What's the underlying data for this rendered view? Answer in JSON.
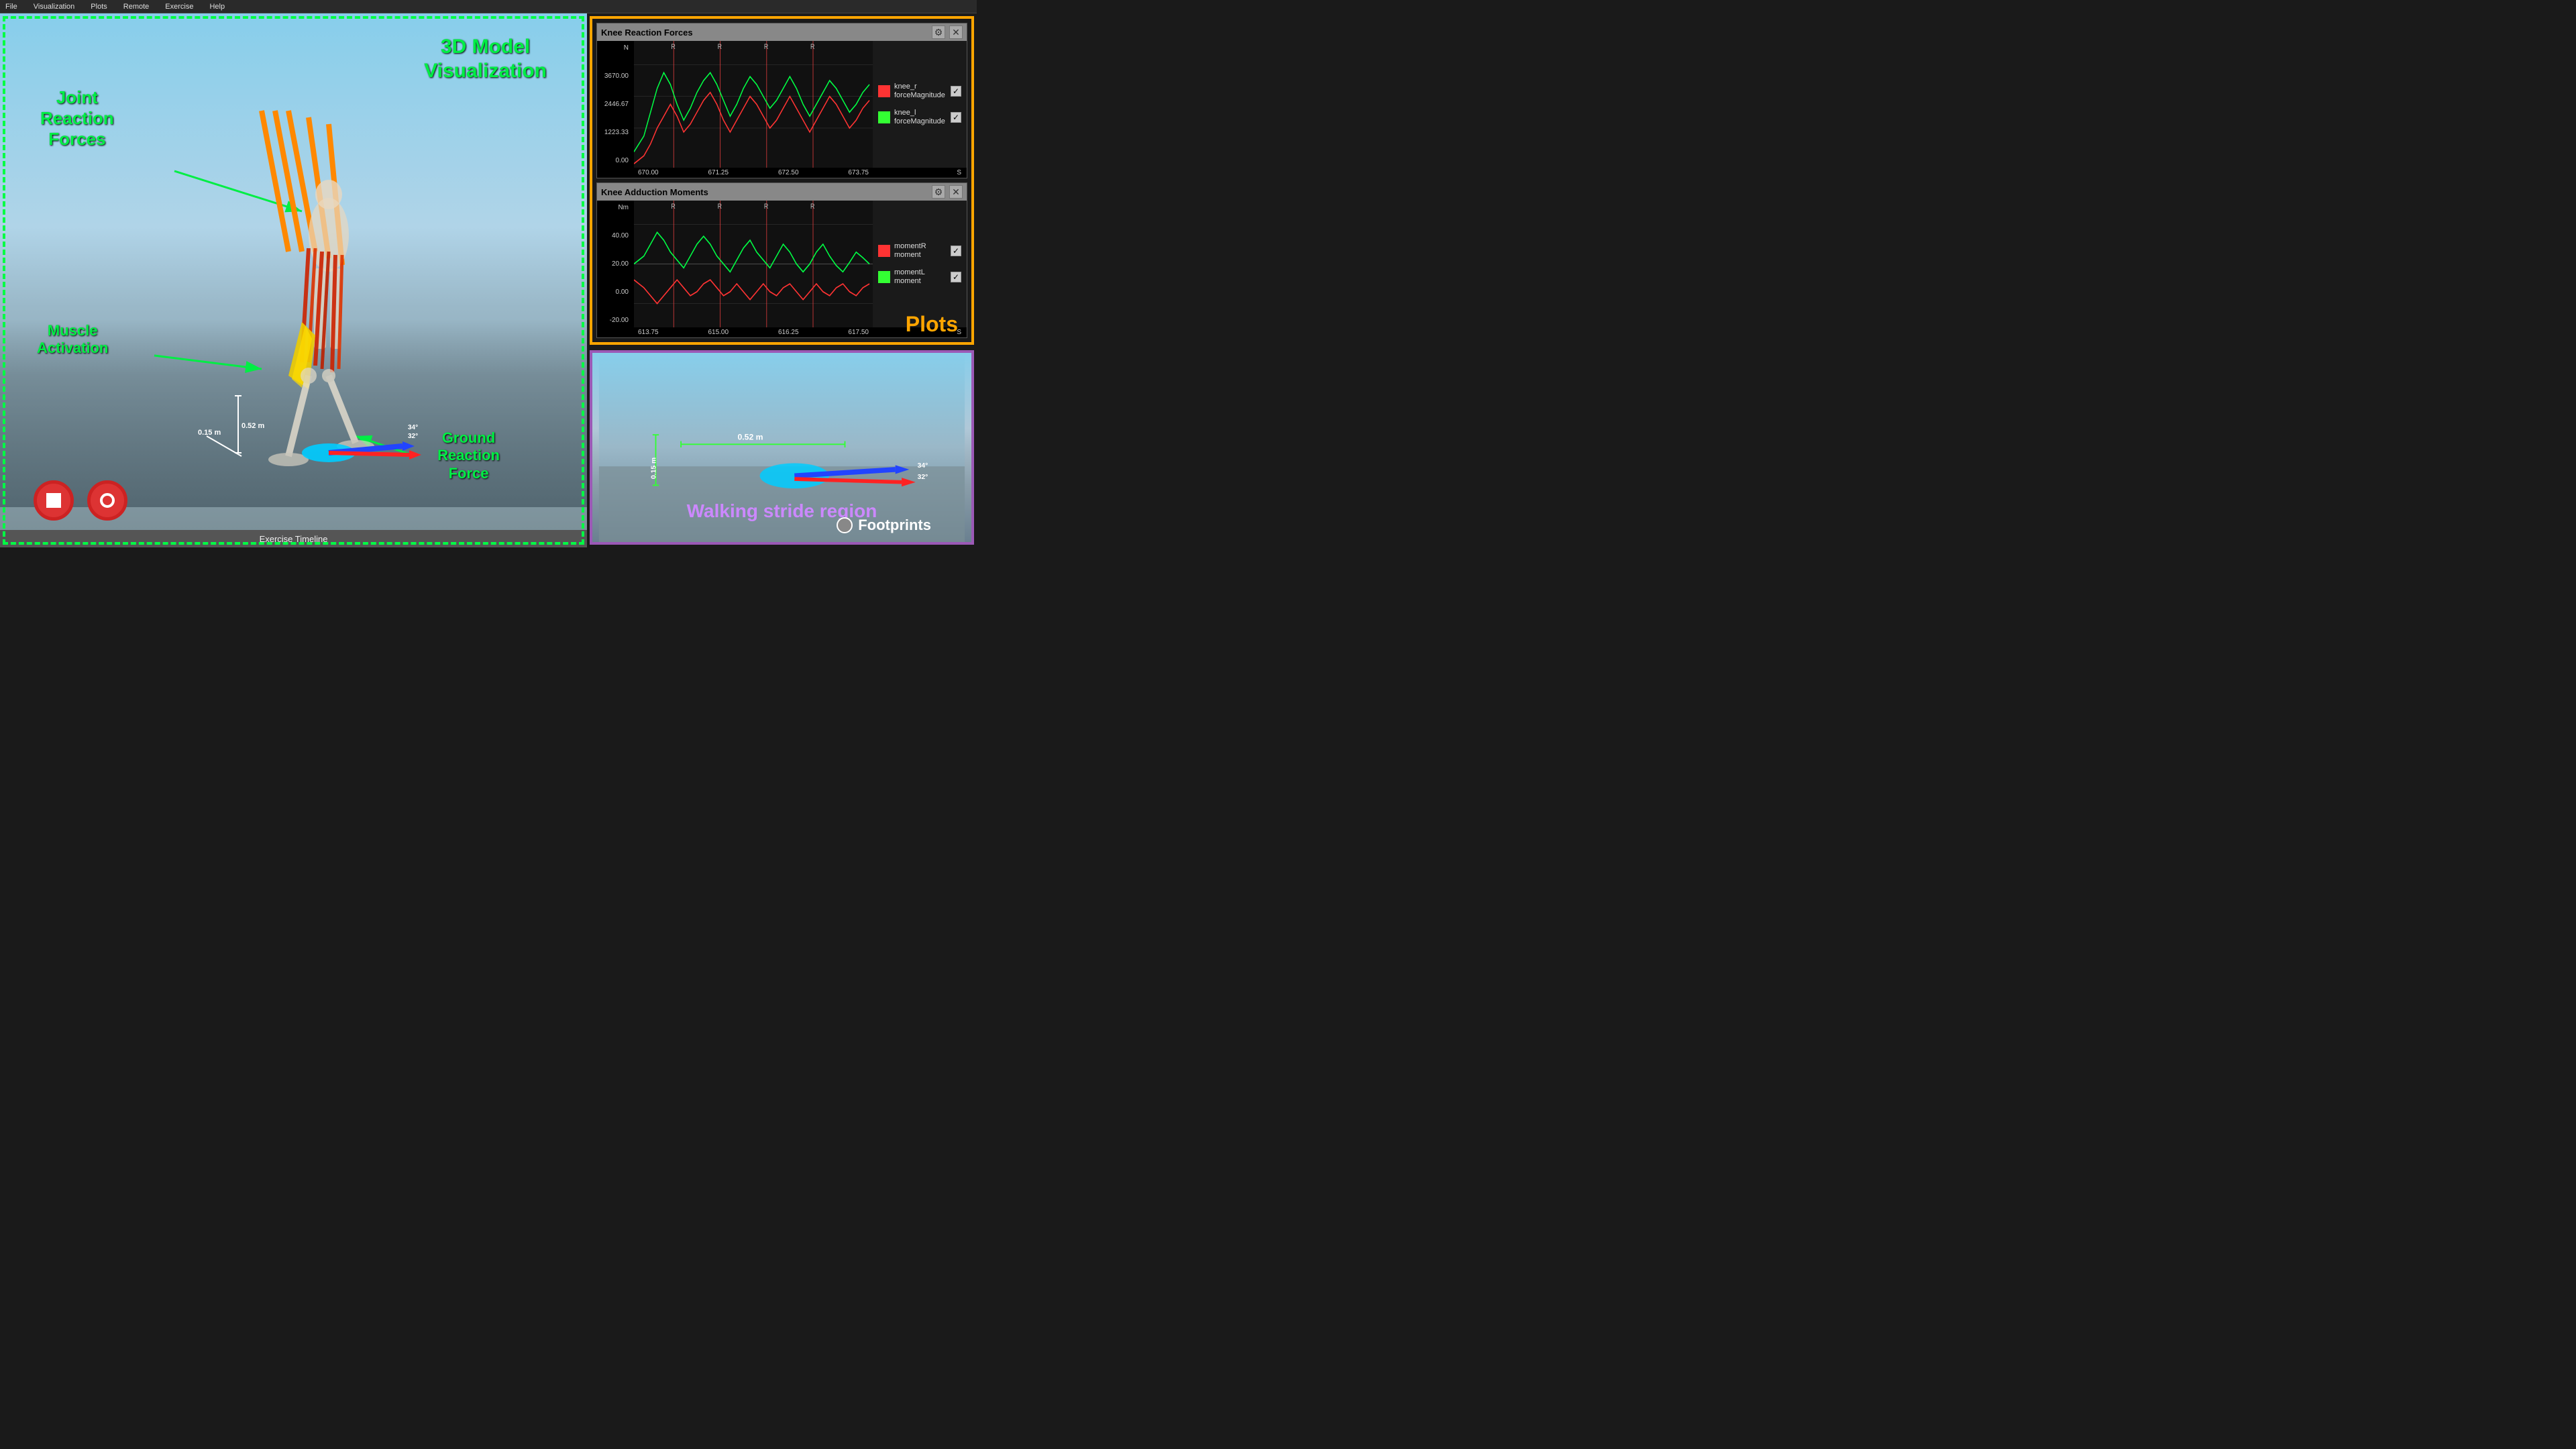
{
  "menu": {
    "items": [
      "File",
      "Visualization",
      "Plots",
      "Remote",
      "Exercise",
      "Help"
    ]
  },
  "viewport": {
    "title_line1": "3D Model",
    "title_line2": "Visualization",
    "label_joint_line1": "Joint",
    "label_joint_line2": "Reaction",
    "label_joint_line3": "Forces",
    "label_muscle_line1": "Muscle",
    "label_muscle_line2": "Activation",
    "label_ground_line1": "Ground",
    "label_ground_line2": "Reaction",
    "label_ground_line3": "Force",
    "measure_052": "0.52 m",
    "measure_015": "0.15 m",
    "measure_34deg": "34°\n32°",
    "timeline": "Exercise Timeline"
  },
  "plots": {
    "label": "Plots",
    "panel1": {
      "title": "Knee Reaction Forces",
      "y_unit": "N",
      "y_max": "3670.00",
      "y_mid1": "2446.67",
      "y_mid2": "1223.33",
      "y_min": "0.00",
      "x_start": "670.00",
      "x_mid1": "671.25",
      "x_mid2": "672.50",
      "x_mid3": "673.75",
      "x_unit": "S",
      "r_markers": [
        "R",
        "R",
        "R",
        "R"
      ],
      "legend": [
        {
          "color": "#ff3333",
          "label": "knee_r\nforceMagnitude",
          "checked": true
        },
        {
          "color": "#33ff33",
          "label": "knee_l\nforceMagnitude",
          "checked": true
        }
      ]
    },
    "panel2": {
      "title": "Knee Adduction Moments",
      "y_unit": "Nm",
      "y_max": "40.00",
      "y_mid1": "20.00",
      "y_mid2": "0.00",
      "y_min": "-20.00",
      "x_start": "613.75",
      "x_mid1": "615.00",
      "x_mid2": "616.25",
      "x_mid3": "617.50",
      "x_unit": "S",
      "r_markers": [
        "R",
        "R",
        "R",
        "R"
      ],
      "legend": [
        {
          "color": "#ff3333",
          "label": "momentR\nmoment",
          "checked": true
        },
        {
          "color": "#33ff33",
          "label": "momentL\nmoment",
          "checked": true
        }
      ]
    }
  },
  "footprint": {
    "walking_stride_label": "Walking stride region",
    "footprints_label": "Footprints",
    "measure_052": "0.52 m",
    "measure_015": "0.15 m",
    "measure_34deg": "34°\n32°"
  }
}
